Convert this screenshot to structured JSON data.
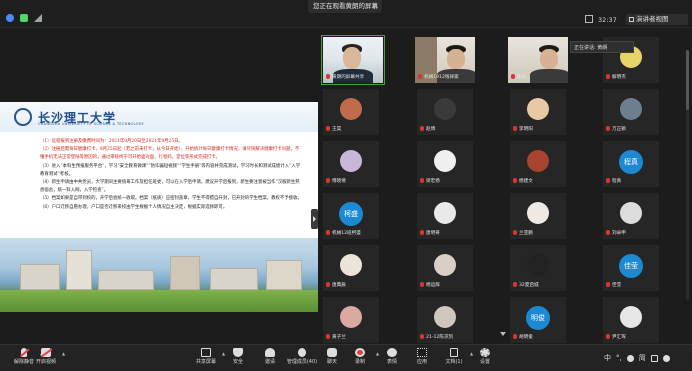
{
  "top_bar": {
    "share_banner": "您正在观看黄朗的屏幕",
    "close_glyph": "✕",
    "timer": "32:37",
    "view_button": "演讲者视图"
  },
  "speaking": {
    "label": "正在讲话: 黄朗"
  },
  "slide": {
    "university_name": "长沙理工大学",
    "university_en": "CHANGSHA UNIVERSITY OF SCIENCE & TECHNOLOGY",
    "paragraphs": [
      "（1）远程报到注册及缴费时间为：2021年9月20日至2021年9月25日。",
      "（2）注册后需每日健康打卡，8月25日起（若之前未打卡，从今日开始），开始统计每日健康打卡情况，请尽快解决健康打卡问题，不懂手机无法正常登陆等原因的，通过审核终于可开始面对面，行程码，定位等形式完成打卡。",
      "（3）进入“本科生预报服务平台”，学习“安全教育微课”“防诈骗短视频”“学生手册”等内容并完成测试，学习时长和测试成绩计入“入学教育测试”考核。",
      "（4）新生申请由中共党员，大学期间主要统筹工作及担任班委，可以在入学后申请，建议开学后报到，新生要注意被当作“汉服新生熟悉宿舍，统一科入网，入学检查”。",
      "（5）档案如果是自带到校的，开学后会统一收取。档案（纸质）应密封盖章，学生不得擅自开封，已开封的学生档案，教校不予接收。",
      "（6）户口迁移自愿办理，户口是否迁移来校由学生根据个人情况自主决定，根据实际选择即可。"
    ]
  },
  "participants": [
    {
      "name": "黄朗的屏幕共享",
      "type": "video",
      "active": true
    },
    {
      "name": "机械1912钱祥家",
      "type": "video"
    },
    {
      "name": "陈彪",
      "type": "video"
    },
    {
      "name": "解明杰",
      "type": "avatar"
    },
    {
      "name": "王昊",
      "type": "avatar"
    },
    {
      "name": "赵博",
      "type": "avatar"
    },
    {
      "name": "李明阳",
      "type": "avatar"
    },
    {
      "name": "万正颖",
      "type": "avatar"
    },
    {
      "name": "傅晓倩",
      "type": "avatar"
    },
    {
      "name": "梁宏扬",
      "type": "avatar"
    },
    {
      "name": "杨建文",
      "type": "avatar"
    },
    {
      "name": "程真",
      "type": "text",
      "avatar_text": "程真"
    },
    {
      "name": "机械12班柯盛",
      "type": "text",
      "avatar_text": "柯盛"
    },
    {
      "name": "唐明奇",
      "type": "avatar"
    },
    {
      "name": "兰亚鹏",
      "type": "avatar"
    },
    {
      "name": "刘卓申",
      "type": "avatar"
    },
    {
      "name": "唐典辰",
      "type": "avatar"
    },
    {
      "name": "杨运辉",
      "type": "avatar"
    },
    {
      "name": "32夏启城",
      "type": "avatar"
    },
    {
      "name": "佳莹",
      "type": "text",
      "avatar_text": "佳莹"
    },
    {
      "name": "黄子兰",
      "type": "avatar"
    },
    {
      "name": "21-12陈京凯",
      "type": "avatar"
    },
    {
      "name": "胡明俊",
      "type": "text",
      "avatar_text": "明俊"
    },
    {
      "name": "尹汇珲",
      "type": "avatar"
    }
  ],
  "toolbar": {
    "unmute": "解除静音",
    "start_video": "开启视频",
    "share": "共享屏幕",
    "security": "安全",
    "invite": "邀请",
    "participants": "管理成员(40)",
    "chat": "聊天",
    "record": "录制",
    "react": "表情",
    "apps": "应用",
    "docs": "文档(1)",
    "settings": "设置"
  },
  "tray": {
    "ime": "中",
    "ime_simp": "简",
    "punct": "°,"
  },
  "colors": {
    "accent_blue": "#1b8ad3",
    "red_text": "#d0261c",
    "active_border": "#4f9d3a"
  }
}
